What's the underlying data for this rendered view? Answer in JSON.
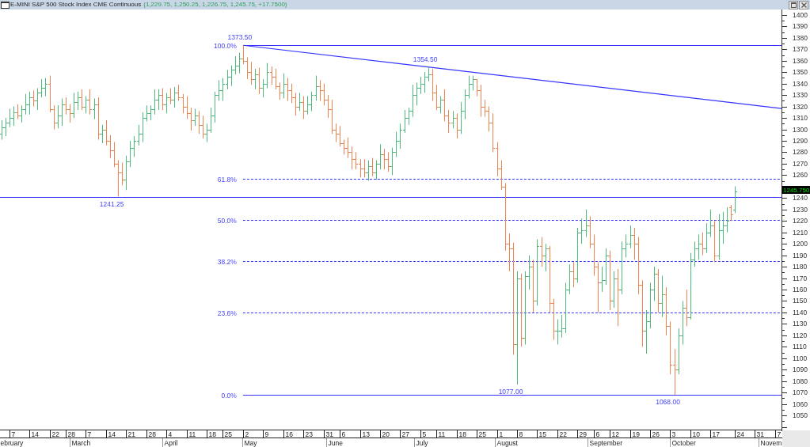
{
  "window": {
    "title": "E-MINI S&P 500 Stock Index CME Continuous",
    "quote": "(1,229.75, 1,250.25, 1,226.75, 1,245.75, +17.7500)",
    "buttons": [
      {
        "kind": "restore"
      },
      {
        "kind": "close"
      }
    ]
  },
  "chart": {
    "price_labels": [
      "1373.50",
      "1354.50",
      "1241.25",
      "1077.00",
      "1068.00"
    ],
    "fib_labels": [
      "100.0%",
      "61.8%",
      "50.0%",
      "38.2%",
      "23.6%",
      "0.0%"
    ],
    "last_price": "1245.750",
    "price_axis_labels": [
      "1400",
      "1390",
      "1380",
      "1370",
      "1360",
      "1350",
      "1340",
      "1330",
      "1320",
      "1310",
      "1300",
      "1290",
      "1280",
      "1270",
      "1260",
      "1240",
      "1230",
      "1220",
      "1210",
      "1200",
      "1190",
      "1180",
      "1170",
      "1160",
      "1150",
      "1140",
      "1130",
      "1120",
      "1110",
      "1100",
      "1090",
      "1080",
      "1070",
      "1060",
      "1050"
    ],
    "date_labels": [
      "7",
      "14",
      "22",
      "28",
      "7",
      "14",
      "21",
      "28",
      "4",
      "11",
      "18",
      "25",
      "2",
      "9",
      "16",
      "23",
      "31",
      "6",
      "13",
      "20",
      "27",
      "5",
      "11",
      "18",
      "25",
      "1",
      "8",
      "15",
      "22",
      "29",
      "6",
      "12",
      "19",
      "26",
      "3",
      "10",
      "17",
      "24",
      "31",
      "7"
    ],
    "month_labels": [
      "ebruary",
      "March",
      "April",
      "May",
      "June",
      "July",
      "August",
      "September",
      "October",
      "Novem"
    ]
  }
}
